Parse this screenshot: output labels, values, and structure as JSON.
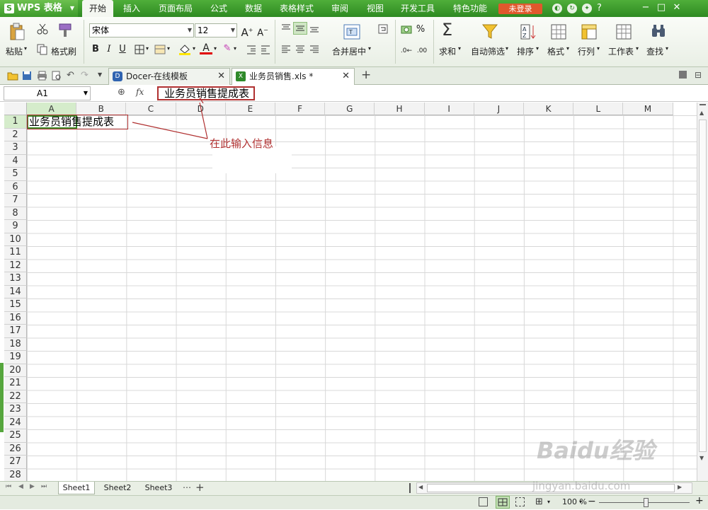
{
  "app": {
    "name": "WPS 表格"
  },
  "menu": {
    "tabs": [
      "开始",
      "插入",
      "页面布局",
      "公式",
      "数据",
      "表格样式",
      "审阅",
      "视图",
      "开发工具",
      "特色功能"
    ],
    "login": "未登录",
    "help": "?"
  },
  "ribbon": {
    "paste": "粘贴",
    "format_painter": "格式刷",
    "font_name": "宋体",
    "font_size": "12",
    "bold": "B",
    "italic": "I",
    "underline": "U",
    "merge_center": "合并居中",
    "sum": "求和",
    "autofilter": "自动筛选",
    "sort": "排序",
    "format": "格式",
    "rowcol": "行列",
    "worksheet": "工作表",
    "find": "查找"
  },
  "doc_tabs": [
    {
      "label": "Docer-在线模板"
    },
    {
      "label": "业务员销售.xls *"
    }
  ],
  "formula_bar": {
    "name_box": "A1",
    "fx": "fx",
    "content": "业务员销售提成表"
  },
  "grid": {
    "columns": [
      "A",
      "B",
      "C",
      "D",
      "E",
      "F",
      "G",
      "H",
      "I",
      "J",
      "K",
      "L",
      "M"
    ],
    "rows": [
      "1",
      "2",
      "3",
      "4",
      "5",
      "6",
      "7",
      "8",
      "9",
      "10",
      "11",
      "12",
      "13",
      "14",
      "15",
      "16",
      "17",
      "18",
      "19",
      "20",
      "21",
      "22",
      "23",
      "24",
      "25",
      "26",
      "27",
      "28"
    ],
    "cell_a1": "业务员销售提成表"
  },
  "annotation": {
    "label": "在此输入信息"
  },
  "sheets": [
    "Sheet1",
    "Sheet2",
    "Sheet3"
  ],
  "status": {
    "zoom": "100 %"
  },
  "watermark": {
    "main": "Baidu经验",
    "sub": "jingyan.baidu.com"
  }
}
